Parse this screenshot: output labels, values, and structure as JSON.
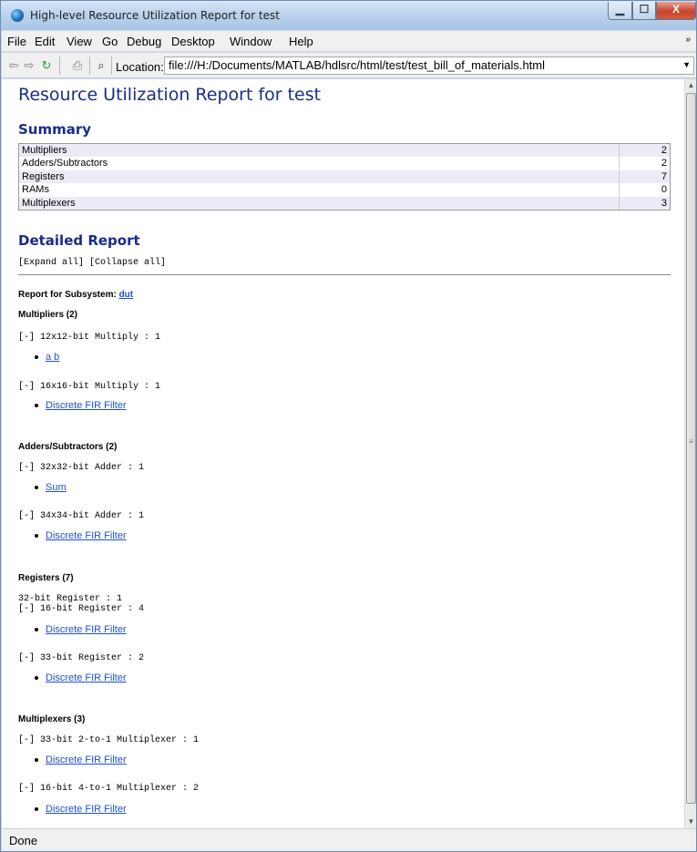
{
  "window": {
    "title": "High-level Resource Utilization Report for test",
    "min_glyph": "▁",
    "max_glyph": "☐",
    "close_glyph": "X"
  },
  "menu": [
    "File",
    "Edit",
    "View",
    "Go",
    "Debug",
    "Desktop",
    "Window",
    "Help"
  ],
  "menu_overflow": "»",
  "toolbar": {
    "location_label": "Location:",
    "location_value": "file:///H:/Documents/MATLAB/hdlsrc/html/test/test_bill_of_materials.html",
    "icons": [
      "back-icon",
      "forward-icon",
      "refresh-icon",
      "print-icon",
      "find-icon"
    ]
  },
  "report": {
    "title": "Resource Utilization Report for test",
    "summary_heading": "Summary",
    "summary": [
      {
        "label": "Multipliers",
        "value": "2"
      },
      {
        "label": "Adders/Subtractors",
        "value": "2"
      },
      {
        "label": "Registers",
        "value": "7"
      },
      {
        "label": "RAMs",
        "value": "0"
      },
      {
        "label": "Multiplexers",
        "value": "3"
      }
    ],
    "detailed_heading": "Detailed Report",
    "expand_all": "[Expand all]",
    "collapse_all": "[Collapse all]",
    "subsystem_label": "Report for Subsystem:",
    "subsystem_link": "dut",
    "mult_heading": "Multipliers (2)",
    "mult_1": "[-] 12x12-bit Multiply : 1",
    "mult_1_link": "a b",
    "mult_2": "[-] 16x16-bit Multiply : 1",
    "mult_2_link": "Discrete FIR Filter",
    "add_heading": "Adders/Subtractors (2)",
    "add_1": "[-] 32x32-bit Adder : 1",
    "add_1_link": "Sum",
    "add_2": "[-] 34x34-bit Adder : 1",
    "add_2_link": "Discrete FIR Filter",
    "reg_heading": "Registers (7)",
    "reg_0": "32-bit Register : 1",
    "reg_1": "[-] 16-bit Register : 4",
    "reg_1_link": "Discrete FIR Filter",
    "reg_2": "[-] 33-bit Register : 2",
    "reg_2_link": "Discrete FIR Filter",
    "mux_heading": "Multiplexers (3)",
    "mux_1": "[-] 33-bit 2-to-1 Multiplexer : 1",
    "mux_1_link": "Discrete FIR Filter",
    "mux_2": "[-] 16-bit 4-to-1 Multiplexer : 2",
    "mux_2_link": "Discrete FIR Filter"
  },
  "status": "Done"
}
